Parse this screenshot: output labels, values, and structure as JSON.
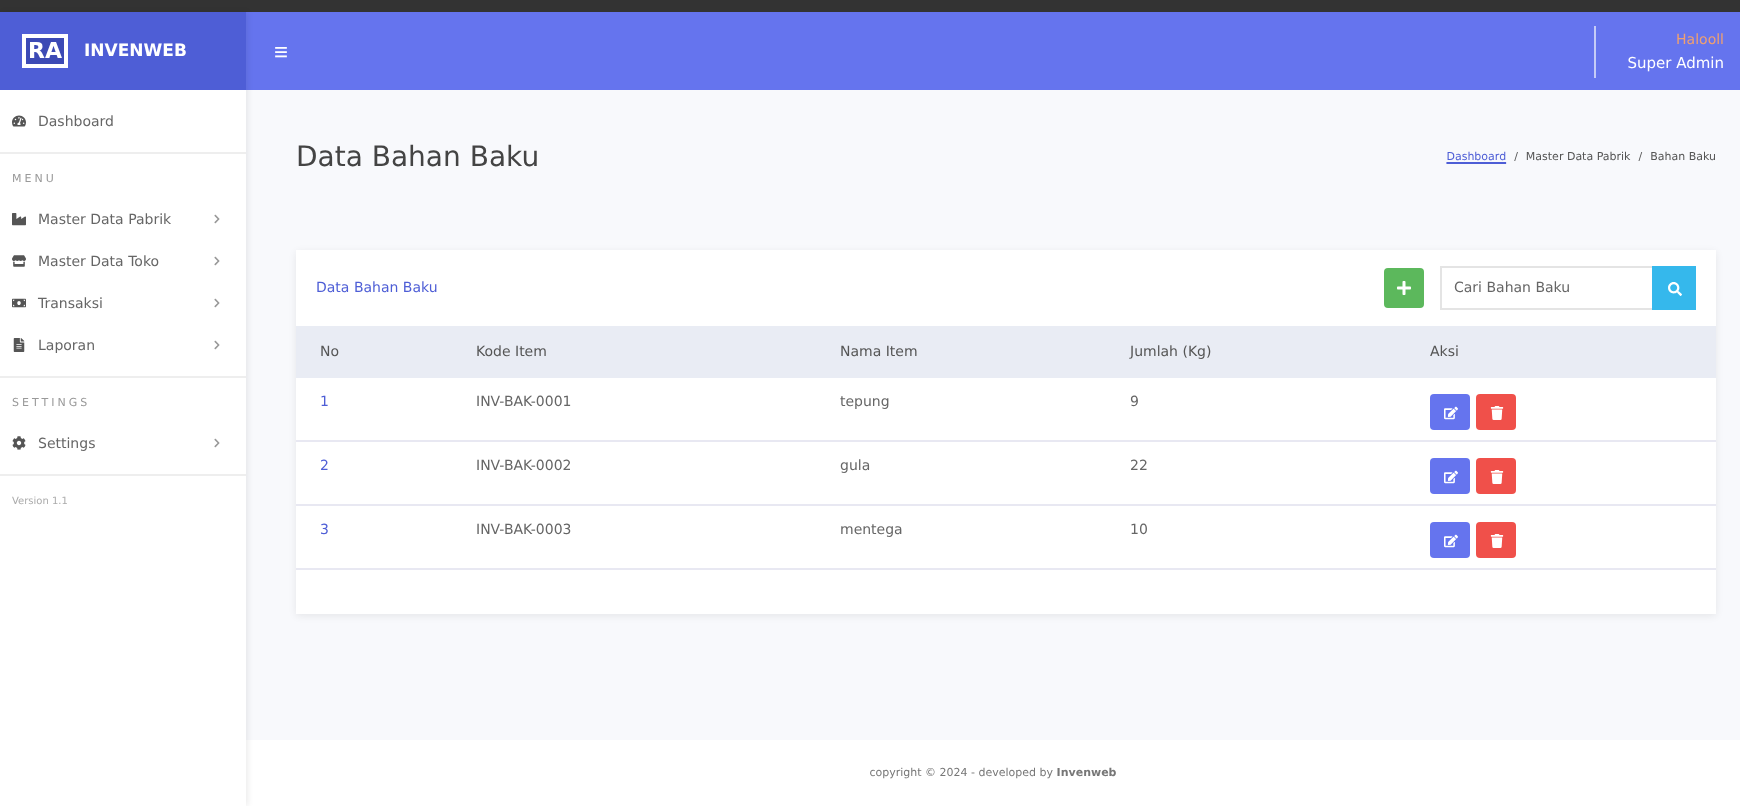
{
  "brand": {
    "logo": "RA",
    "name": "INVENWEB"
  },
  "topbar": {
    "menu_glyph": "≡",
    "greeting": "Halooll",
    "user": "Super Admin"
  },
  "sidebar": [
    {
      "kind": "link",
      "label": "Dashboard",
      "arrow": false
    },
    {
      "kind": "heading",
      "label": "MENU"
    },
    {
      "kind": "link",
      "label": "Master Data Pabrik",
      "arrow": true
    },
    {
      "kind": "link",
      "label": "Master Data Toko",
      "arrow": true
    },
    {
      "kind": "link",
      "label": "Transaksi",
      "arrow": true
    },
    {
      "kind": "link",
      "label": "Laporan",
      "arrow": true
    },
    {
      "kind": "heading",
      "label": "SETTINGS"
    },
    {
      "kind": "link",
      "label": "Settings",
      "arrow": true
    },
    {
      "kind": "version",
      "label": "Version 1.1"
    }
  ],
  "page_title": "Data Bahan Baku",
  "breadcrumb": {
    "separator": "/",
    "items": [
      "Dashboard",
      "Master Data Pabrik",
      "Bahan Baku"
    ]
  },
  "card": {
    "title": "Data Bahan Baku",
    "search": {
      "placeholder": "Cari Bahan Baku"
    }
  },
  "table": {
    "columns": [
      "No",
      "Kode Item",
      "Nama Item",
      "Jumlah (Kg)",
      "Aksi"
    ],
    "rows": [
      [
        "1",
        "INV-BAK-0001",
        "tepung",
        "9"
      ],
      [
        "2",
        "INV-BAK-0002",
        "gula",
        "22"
      ],
      [
        "3",
        "INV-BAK-0003",
        "mentega",
        "10"
      ]
    ]
  },
  "footer": "copyright © 2024 - developed by **Invenweb**"
}
